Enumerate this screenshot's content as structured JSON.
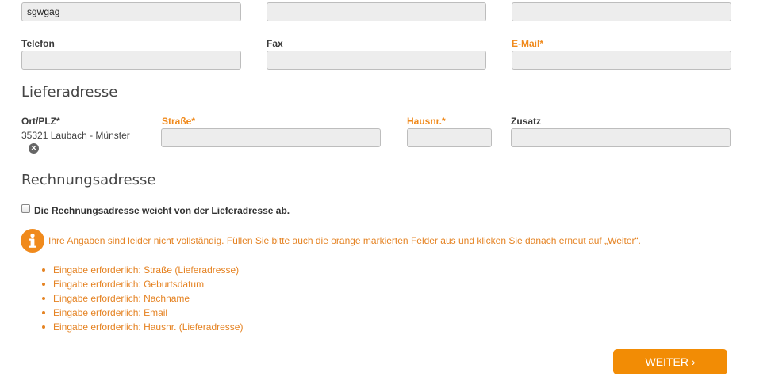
{
  "top_row": {
    "field1_value": "sgwgag",
    "field2_value": "",
    "field3_value": ""
  },
  "contact": {
    "telefon_label": "Telefon",
    "fax_label": "Fax",
    "email_label": "E-Mail*"
  },
  "delivery": {
    "heading": "Lieferadresse",
    "ort_plz_label": "Ort/PLZ*",
    "ort_plz_value": "35321 Laubach - Münster",
    "strasse_label": "Straße*",
    "hausnr_label": "Hausnr.*",
    "zusatz_label": "Zusatz"
  },
  "billing": {
    "heading": "Rechnungsadresse",
    "different_checkbox_label": "Die Rechnungsadresse weicht von der Lieferadresse ab."
  },
  "notice": {
    "message": "Ihre Angaben sind leider nicht vollständig. Füllen Sie bitte auch die orange markierten Felder aus und klicken Sie danach erneut auf „Weiter“.",
    "errors": [
      "Eingabe erforderlich: Straße (Lieferadresse)",
      "Eingabe erforderlich: Geburtsdatum",
      "Eingabe erforderlich: Nachname",
      "Eingabe erforderlich: Email",
      "Eingabe erforderlich: Hausnr. (Lieferadresse)"
    ]
  },
  "actions": {
    "next_label": "WEITER ›"
  },
  "colors": {
    "accent": "#f28c05",
    "required_label": "#f08a1c",
    "field_bg": "#ededed"
  }
}
